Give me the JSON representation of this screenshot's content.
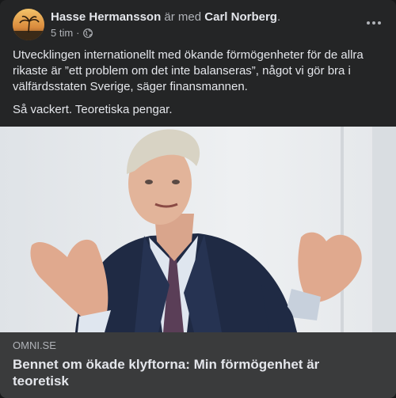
{
  "post": {
    "author": "Hasse Hermansson",
    "with_text": " är med ",
    "tagged": "Carl Norberg",
    "tagged_suffix": ".",
    "time": "5 tim",
    "separator": "·",
    "privacy_icon": "globe-icon",
    "more_icon": "more-horizontal-icon",
    "paragraphs": [
      "Utvecklingen internationellt med ökande förmögenheter för de allra rikaste är ”ett problem om det inte balanseras”, något vi gör bra i välfärdsstaten Sverige, säger finansmannen.",
      "Så vackert. Teoretiska pengar."
    ]
  },
  "link_preview": {
    "domain": "OMNI.SE",
    "headline": "Bennet om ökade klyftorna: Min förmögenhet är teoretisk"
  },
  "colors": {
    "background": "#18191a",
    "card": "#242526",
    "preview_bg": "#3a3b3c",
    "text_primary": "#e4e6eb",
    "text_secondary": "#b0b3b8"
  }
}
